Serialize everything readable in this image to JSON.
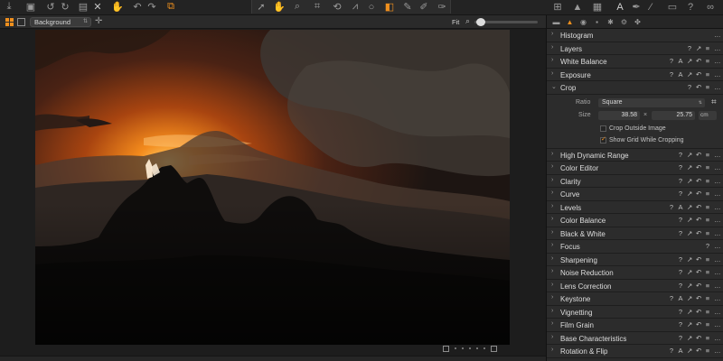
{
  "toolbar": {
    "left_icons": [
      "import-icon",
      "camera-icon",
      "rotate-left-icon",
      "rotate-right-icon",
      "export-icon",
      "delete-icon",
      "reset-icon",
      "undo-icon",
      "redo-icon",
      "copy-apply-icon"
    ],
    "center_icons": [
      "cursor-tool-icon",
      "pan-tool-icon",
      "zoom-tool-icon",
      "crop-tool-icon",
      "rotate-tool-icon",
      "keystone-tool-icon",
      "spot-removal-icon",
      "layer-mask-icon",
      "brush-tool-icon",
      "eraser-tool-icon",
      "gradient-tool-icon",
      "color-picker-icon"
    ],
    "right_icons": [
      "browser-grid-icon",
      "warning-icon",
      "viewer-layout-icon",
      "text-overlay-icon",
      "picker-icon",
      "wand-icon",
      "settings-icon",
      "help-icon",
      "glasses-icon"
    ]
  },
  "viewer_header": {
    "variant_select": "Background",
    "zoom_label": "Fit"
  },
  "tool_tabs": [
    "library-tab",
    "adjustments-tab",
    "capture-tab",
    "metadata-tab",
    "settings-tab",
    "output-tab",
    "layers-tab"
  ],
  "sections_top": [
    {
      "title": "Histogram",
      "expanded": false,
      "acts": [
        "…"
      ]
    },
    {
      "title": "Layers",
      "expanded": false,
      "acts": [
        "?",
        "↗",
        "≡",
        "…"
      ]
    },
    {
      "title": "White Balance",
      "expanded": false,
      "acts": [
        "?",
        "A",
        "↗",
        "↶",
        "≡",
        "…"
      ]
    },
    {
      "title": "Exposure",
      "expanded": false,
      "acts": [
        "?",
        "A",
        "↗",
        "↶",
        "≡",
        "…"
      ]
    },
    {
      "title": "Crop",
      "expanded": true,
      "acts": [
        "?",
        "↶",
        "≡",
        "…"
      ]
    }
  ],
  "crop": {
    "ratio_label": "Ratio",
    "ratio_value": "Square",
    "size_label": "Size",
    "width": "38.58",
    "separator": "×",
    "height": "25.75",
    "unit": "cm",
    "crop_outside_label": "Crop Outside Image",
    "crop_outside_checked": false,
    "show_grid_label": "Show Grid While Cropping",
    "show_grid_checked": true
  },
  "sections_bottom": [
    {
      "title": "High Dynamic Range",
      "acts": [
        "?",
        "↗",
        "↶",
        "≡",
        "…"
      ]
    },
    {
      "title": "Color Editor",
      "acts": [
        "?",
        "↗",
        "↶",
        "≡",
        "…"
      ]
    },
    {
      "title": "Clarity",
      "acts": [
        "?",
        "↗",
        "↶",
        "≡",
        "…"
      ]
    },
    {
      "title": "Curve",
      "acts": [
        "?",
        "↗",
        "↶",
        "≡",
        "…"
      ]
    },
    {
      "title": "Levels",
      "acts": [
        "?",
        "A",
        "↗",
        "↶",
        "≡",
        "…"
      ]
    },
    {
      "title": "Color Balance",
      "acts": [
        "?",
        "↗",
        "↶",
        "≡",
        "…"
      ]
    },
    {
      "title": "Black & White",
      "acts": [
        "?",
        "↗",
        "↶",
        "≡",
        "…"
      ]
    },
    {
      "title": "Focus",
      "acts": [
        "?",
        "…"
      ]
    },
    {
      "title": "Sharpening",
      "acts": [
        "?",
        "↗",
        "↶",
        "≡",
        "…"
      ]
    },
    {
      "title": "Noise Reduction",
      "acts": [
        "?",
        "↗",
        "↶",
        "≡",
        "…"
      ]
    },
    {
      "title": "Lens Correction",
      "acts": [
        "?",
        "↗",
        "↶",
        "≡",
        "…"
      ]
    },
    {
      "title": "Keystone",
      "acts": [
        "?",
        "A",
        "↗",
        "↶",
        "≡",
        "…"
      ]
    },
    {
      "title": "Vignetting",
      "acts": [
        "?",
        "↗",
        "↶",
        "≡",
        "…"
      ]
    },
    {
      "title": "Film Grain",
      "acts": [
        "?",
        "↗",
        "↶",
        "≡",
        "…"
      ]
    },
    {
      "title": "Base Characteristics",
      "acts": [
        "?",
        "↗",
        "↶",
        "≡",
        "…"
      ]
    },
    {
      "title": "Rotation & Flip",
      "acts": [
        "?",
        "A",
        "↗",
        "↶",
        "≡",
        "…"
      ]
    }
  ],
  "colors": {
    "accent": "#f0901e",
    "panel_bg": "#2c2c2c",
    "app_bg": "#1b1b1b"
  }
}
